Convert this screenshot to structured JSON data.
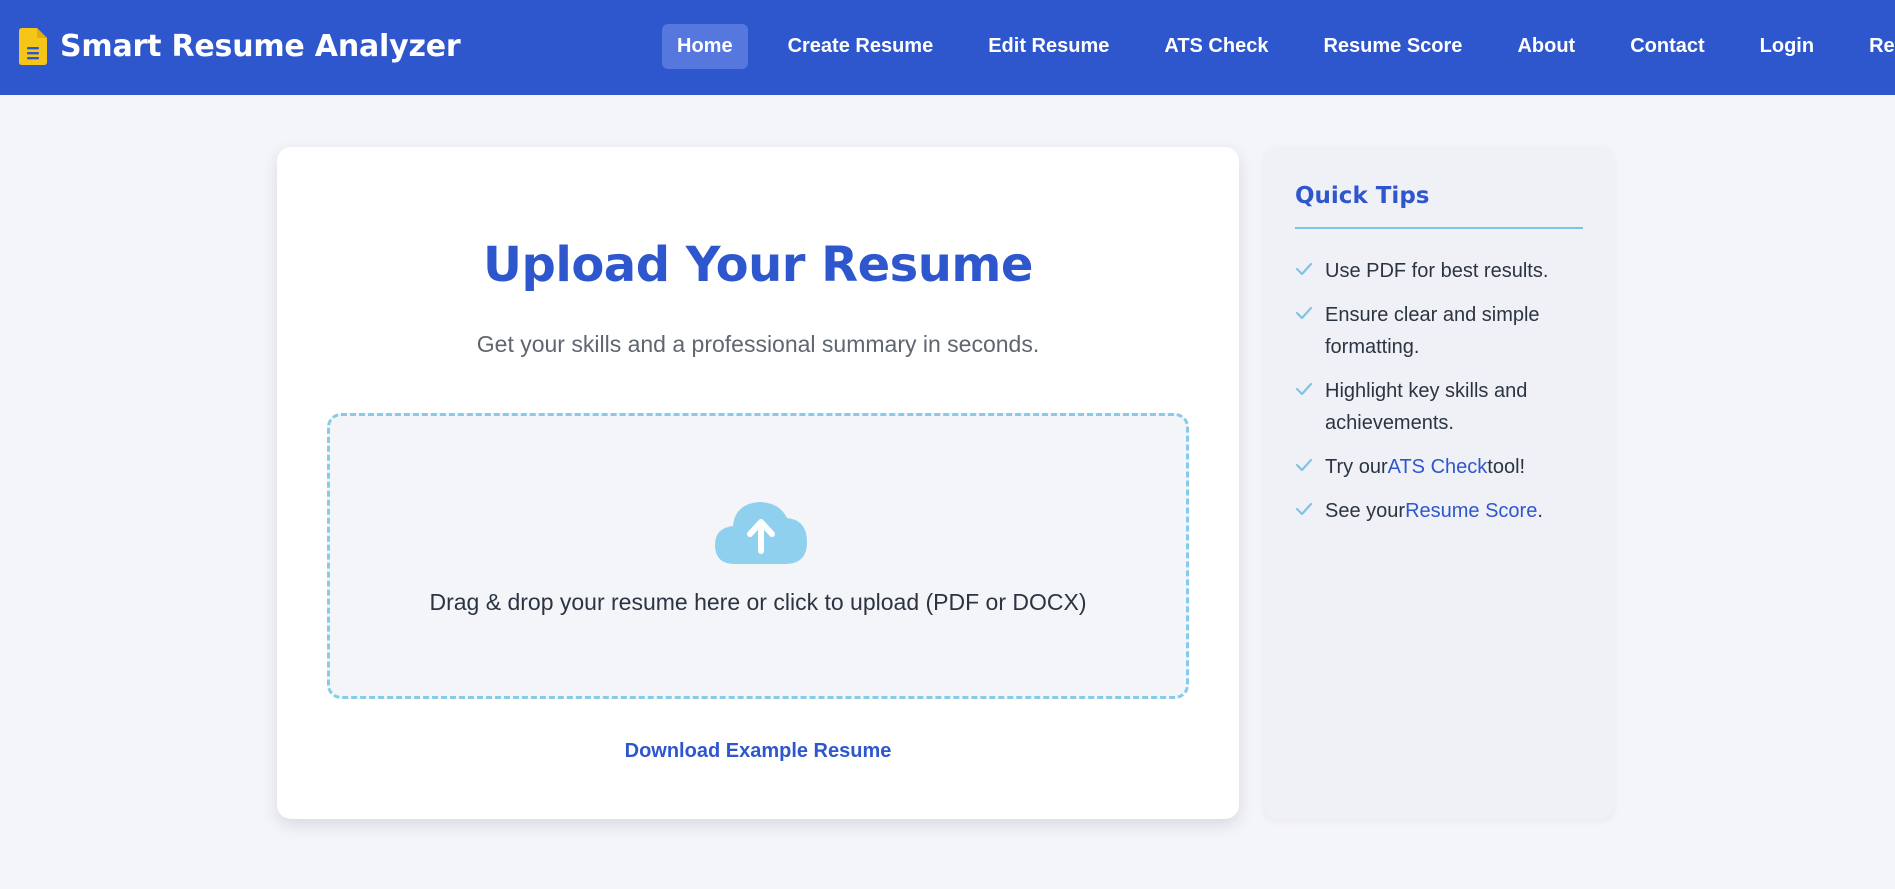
{
  "brand": {
    "name": "Smart Resume Analyzer",
    "icon": "document-icon"
  },
  "nav": {
    "items": [
      {
        "label": "Home",
        "active": true
      },
      {
        "label": "Create Resume",
        "active": false
      },
      {
        "label": "Edit Resume",
        "active": false
      },
      {
        "label": "ATS Check",
        "active": false
      },
      {
        "label": "Resume Score",
        "active": false
      },
      {
        "label": "About",
        "active": false
      },
      {
        "label": "Contact",
        "active": false
      },
      {
        "label": "Login",
        "active": false
      },
      {
        "label": "Register",
        "active": false
      }
    ]
  },
  "upload": {
    "title": "Upload Your Resume",
    "subtitle": "Get your skills and a professional summary in seconds.",
    "dropzone_text": "Drag & drop your resume here or click to upload (PDF or DOCX)",
    "dropzone_icon": "cloud-upload-icon",
    "example_link": "Download Example Resume"
  },
  "tips": {
    "title": "Quick Tips",
    "items": [
      {
        "text": "Use PDF for best results."
      },
      {
        "text": "Ensure clear and simple formatting."
      },
      {
        "text": "Highlight key skills and achievements."
      },
      {
        "before": "Try our",
        "link": "ATS Check",
        "after": "tool!"
      },
      {
        "before": "See your",
        "link": "Resume Score",
        "after": "."
      }
    ]
  },
  "colors": {
    "primary": "#2f57cd",
    "accent": "#86cbe8",
    "brand_icon": "#f5c518",
    "background": "#f4f5f9"
  }
}
